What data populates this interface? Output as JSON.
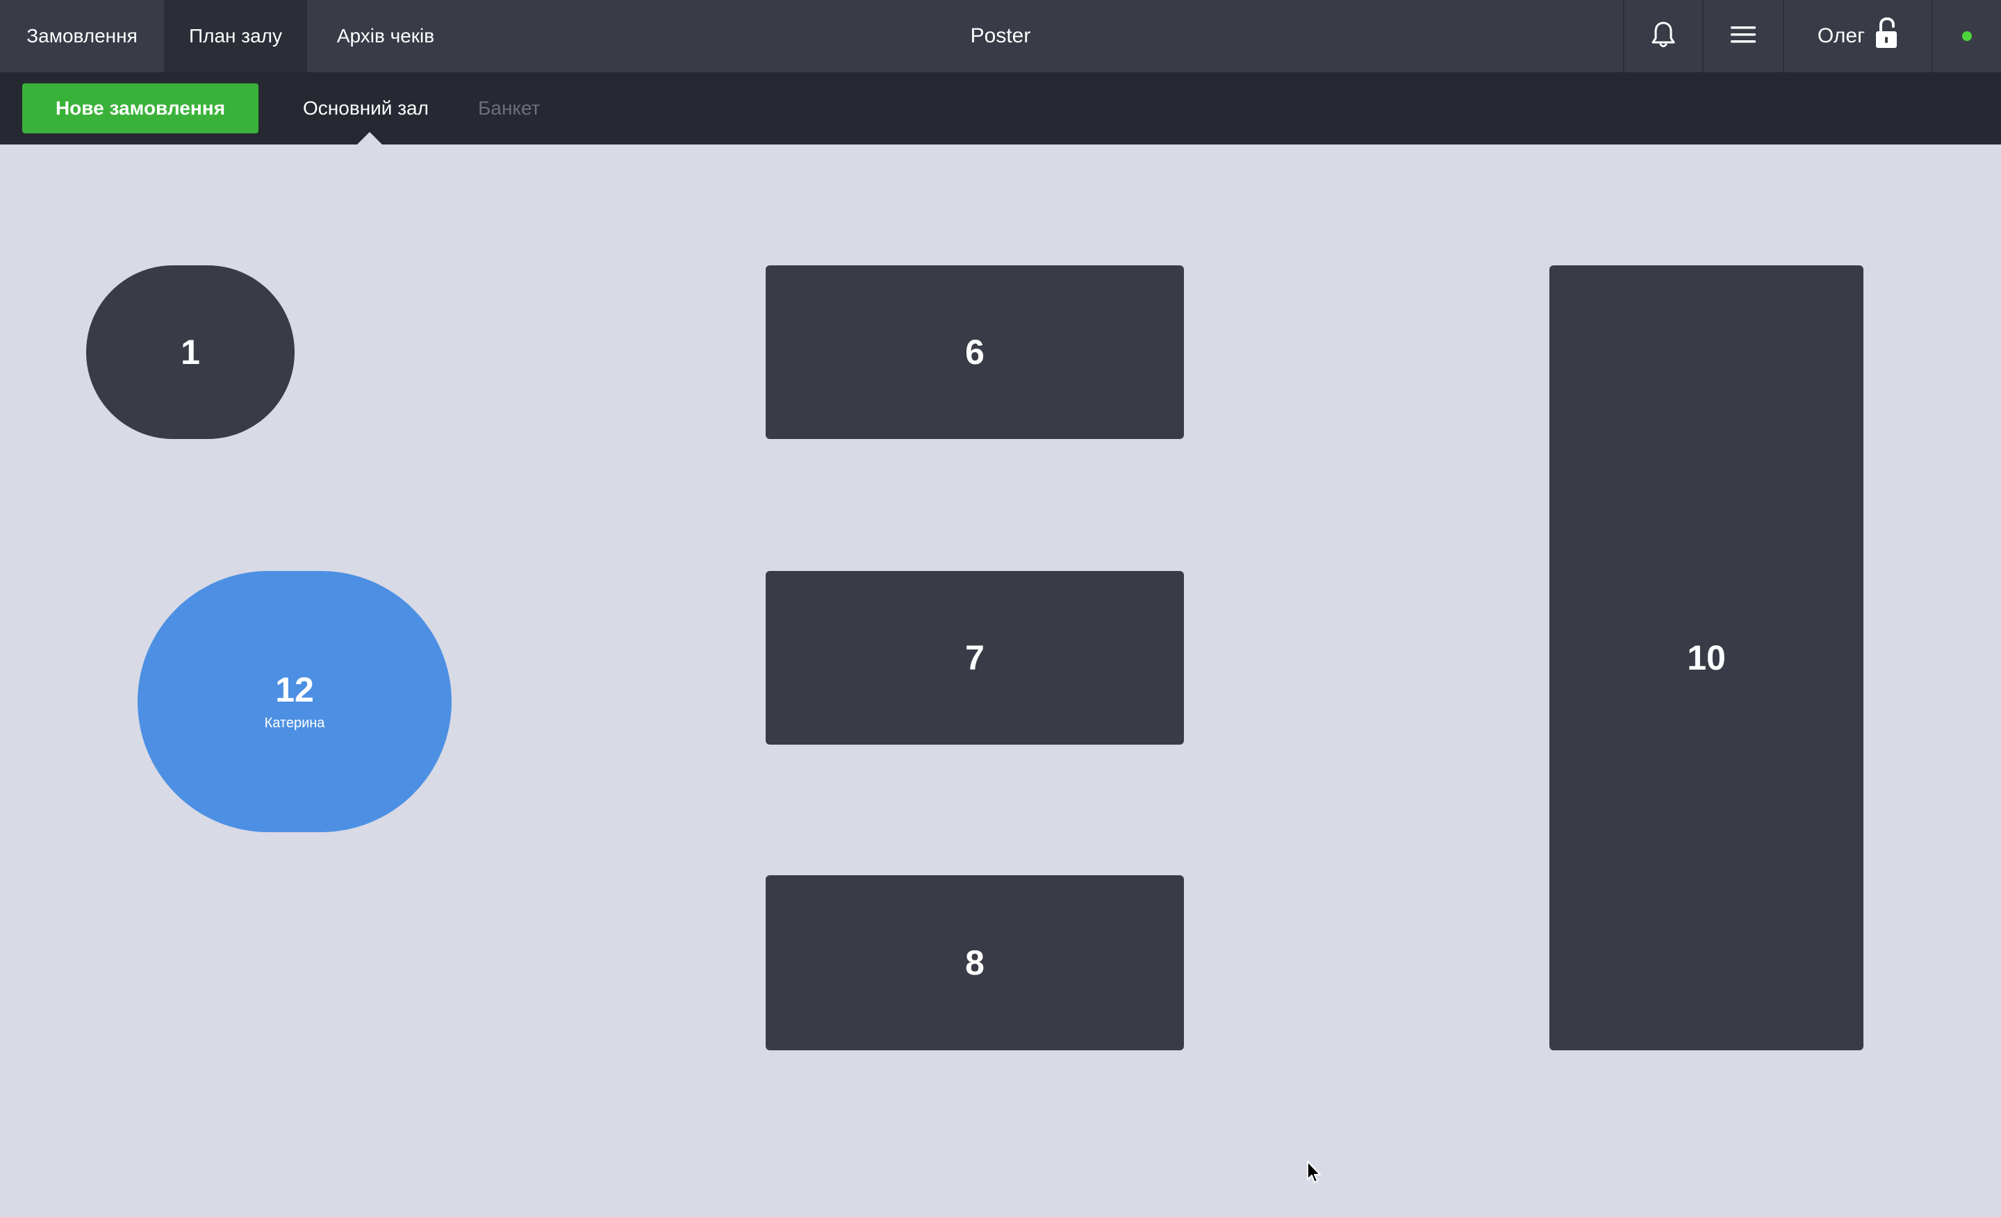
{
  "top_tabs": {
    "orders": "Замовлення",
    "plan": "План залу",
    "archive": "Архів чеків"
  },
  "app_title": "Poster",
  "user": {
    "name": "Олег"
  },
  "sub_bar": {
    "new_order": "Нове замовлення",
    "halls": [
      "Основний зал",
      "Банкет"
    ],
    "active_hall": "Основний зал"
  },
  "tables": [
    {
      "number": "1"
    },
    {
      "number": "12",
      "waiter": "Катерина",
      "occupied": true
    },
    {
      "number": "6"
    },
    {
      "number": "7"
    },
    {
      "number": "8"
    },
    {
      "number": "10"
    }
  ],
  "colors": {
    "top_bar": "#393c47",
    "sub_bar": "#262932",
    "floor": "#d8dae6",
    "table_free": "#393c47",
    "table_occupied": "#4d90e3",
    "accent_green": "#3ab23a",
    "status_online": "#4ed33a"
  },
  "icons": [
    "bell-icon",
    "menu-icon",
    "unlock-icon",
    "status-dot"
  ]
}
